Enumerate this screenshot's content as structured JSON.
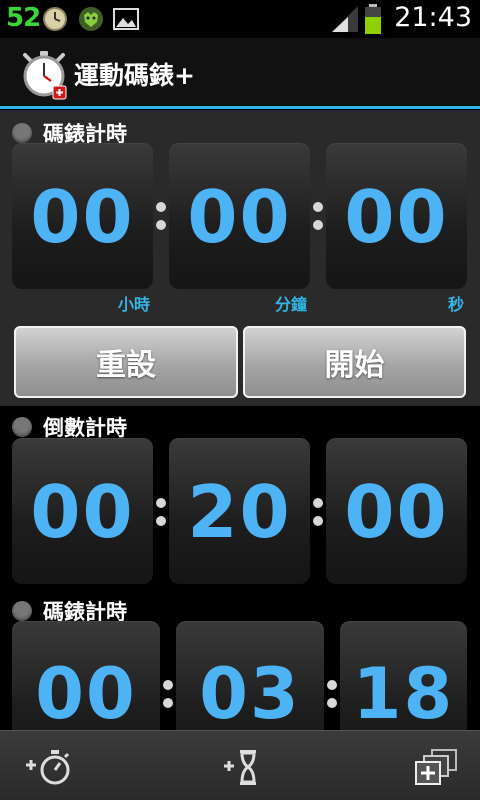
{
  "status_bar": {
    "notification_count": "52",
    "time": "21:43",
    "icons": [
      "clock-icon",
      "tiger-app-icon",
      "gallery-icon",
      "signal-icon",
      "battery-icon"
    ]
  },
  "action_bar": {
    "title": "運動碼錶+",
    "icon": "stopwatch-icon"
  },
  "stopwatch": {
    "label": "碼錶計時",
    "hours": "00",
    "minutes": "00",
    "seconds": "00",
    "unit_hours": "小時",
    "unit_minutes": "分鐘",
    "unit_seconds": "秒",
    "reset_label": "重設",
    "start_label": "開始"
  },
  "countdown": {
    "label": "倒數計時",
    "hours": "00",
    "minutes": "20",
    "seconds": "00"
  },
  "stopwatch2": {
    "label": "碼錶計時",
    "hours": "00",
    "minutes": "03",
    "seconds": "18"
  },
  "bottom_bar": {
    "icons": [
      "add-stopwatch-icon",
      "add-timer-icon",
      "add-panel-icon"
    ]
  },
  "colors": {
    "accent": "#33b5e5",
    "digit": "#4db3f5",
    "notification_green": "#39d53a",
    "battery_green": "#8fd000"
  }
}
